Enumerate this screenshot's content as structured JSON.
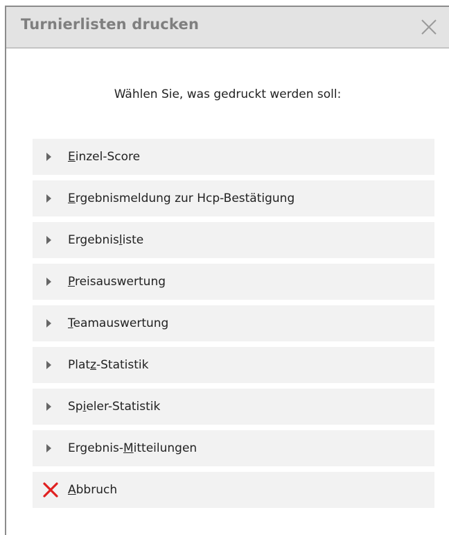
{
  "dialog": {
    "title": "Turnierlisten drucken",
    "close_icon": "close-icon",
    "prompt": "Wählen Sie, was gedruckt werden soll:"
  },
  "options": [
    {
      "pre": "",
      "u": "E",
      "post": "inzel-Score"
    },
    {
      "pre": "",
      "u": "E",
      "post": "rgebnismeldung zur Hcp-Bestätigung"
    },
    {
      "pre": "Ergebnis",
      "u": "l",
      "post": "iste"
    },
    {
      "pre": "",
      "u": "P",
      "post": "reisauswertung"
    },
    {
      "pre": "",
      "u": "T",
      "post": "eamauswertung"
    },
    {
      "pre": "Plat",
      "u": "z",
      "post": "-Statistik"
    },
    {
      "pre": "Sp",
      "u": "i",
      "post": "eler-Statistik"
    },
    {
      "pre": "Ergebnis-",
      "u": "M",
      "post": "itteilungen"
    }
  ],
  "cancel": {
    "pre": "",
    "u": "A",
    "post": "bbruch",
    "icon": "cancel-x-icon",
    "icon_color": "#e02020"
  },
  "colors": {
    "option_bg": "#f2f2f2",
    "titlebar_bg": "#e3e3e3",
    "title_text": "#7f7f7f"
  }
}
